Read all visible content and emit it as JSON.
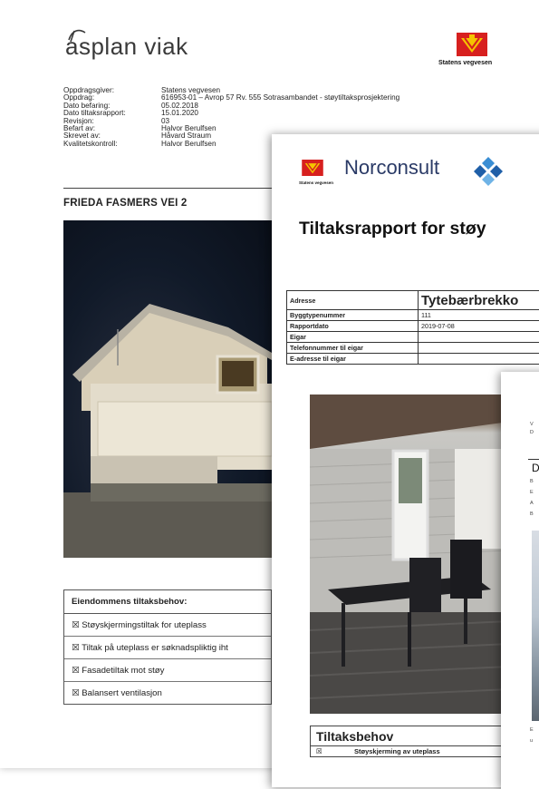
{
  "page1": {
    "logo_text": "asplan viak",
    "sv_label": "Statens vegvesen",
    "meta": [
      {
        "k": "Oppdragsgiver:",
        "v": "Statens vegvesen"
      },
      {
        "k": "Oppdrag:",
        "v": "616953-01 – Avrop 57 Rv. 555 Sotrasambandet - støytiltaksprosjektering"
      },
      {
        "k": "Dato befaring:",
        "v": "05.02.2018"
      },
      {
        "k": "Dato tiltaksrapport:",
        "v": "15.01.2020"
      },
      {
        "k": "Revisjon:",
        "v": "03"
      },
      {
        "k": "Befart av:",
        "v": "Halvor Berulfsen"
      },
      {
        "k": "Skrevet av:",
        "v": "Håvard Straum"
      },
      {
        "k": "Kvalitetskontroll:",
        "v": "Halvor Berulfsen"
      }
    ],
    "address": "FRIEDA FASMERS VEI 2",
    "needs_title": "Eiendommens tiltaksbehov:",
    "needs": [
      "☒ Støyskjermingstiltak for uteplass",
      "☒ Tiltak på uteplass er søknadspliktig iht",
      "☒ Fasadetiltak mot støy",
      "☒ Balansert ventilasjon"
    ]
  },
  "page2": {
    "sv_label": "Statens vegvesen",
    "brand": "Norconsult",
    "title": "Tiltaksrapport for støy",
    "table": [
      {
        "k": "Adresse",
        "v": "Tytebærbrekko"
      },
      {
        "k": "Byggtypenummer",
        "v": "111"
      },
      {
        "k": "Rapportdato",
        "v": "2019-07-08"
      },
      {
        "k": "Eigar",
        "v": ""
      },
      {
        "k": "Telefonnummer til eigar",
        "v": ""
      },
      {
        "k": "E-adresse til eigar",
        "v": ""
      }
    ],
    "needs_title": "Tiltaksbehov",
    "needs_row": {
      "cb": "☒",
      "label": "Støyskjerming av uteplass"
    }
  },
  "page3": {
    "line1": "V",
    "line2": "D",
    "cell_a": "D",
    "rows": [
      "B",
      "E",
      "A",
      "B"
    ],
    "foot1": "E",
    "foot2": "u"
  },
  "colors": {
    "sv_red": "#d7201f",
    "sv_yellow": "#f5c400",
    "norconsult_blue": "#3a8ed4",
    "norconsult_navy": "#2a3a66"
  }
}
